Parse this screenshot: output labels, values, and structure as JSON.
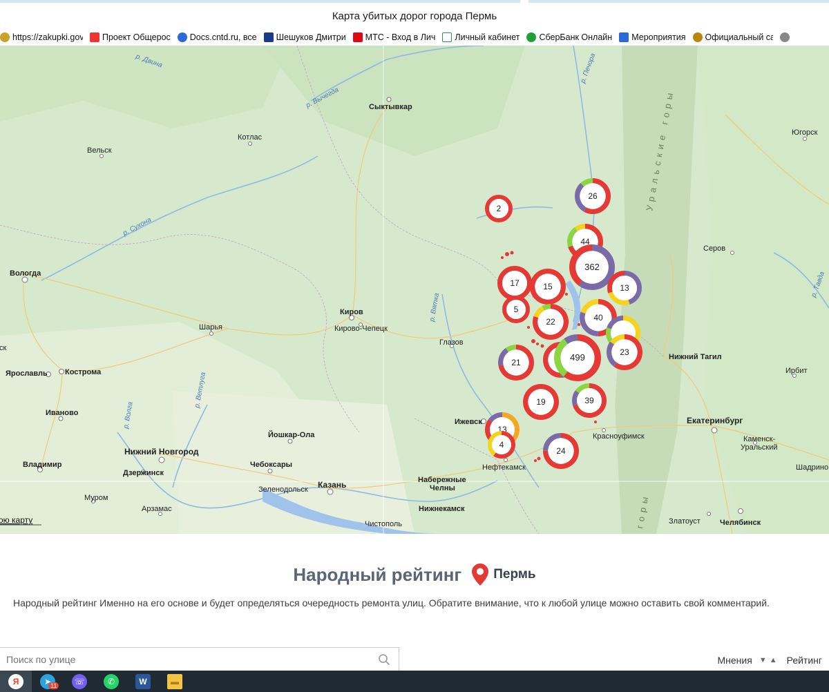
{
  "window": {
    "title": "Карта убитых дорог города Пермь"
  },
  "bookmarks": [
    {
      "label": "https://zakupki.gov",
      "icon": "emblem-icon",
      "color": "#c9a227"
    },
    {
      "label": "Проект Общерос",
      "icon": "doc-icon",
      "color": "#e33"
    },
    {
      "label": "Docs.cntd.ru, все",
      "icon": "docs-icon",
      "color": "#2a6ad8"
    },
    {
      "label": "Шешуков Дмитри",
      "icon": "flag-icon",
      "color": "#1b3a8a"
    },
    {
      "label": "МТС - Вход в Лич",
      "icon": "mts-icon",
      "color": "#e30613"
    },
    {
      "label": "Личный кабинет",
      "icon": "p-icon",
      "color": "#2e8b57"
    },
    {
      "label": "СберБанк Онлайн",
      "icon": "sber-icon",
      "color": "#21a038"
    },
    {
      "label": "Мероприятия",
      "icon": "id-icon",
      "color": "#2a6ad8"
    },
    {
      "label": "Официальный сай",
      "icon": "emblem-icon",
      "color": "#b8860b"
    }
  ],
  "map": {
    "cities": [
      {
        "name": "Сыктывкар",
        "bold": true
      },
      {
        "name": "Котлас",
        "bold": false
      },
      {
        "name": "Вельск",
        "bold": false
      },
      {
        "name": "Вологда",
        "bold": true
      },
      {
        "name": "Киров",
        "bold": true
      },
      {
        "name": "Кирово-Чепецк",
        "bold": false
      },
      {
        "name": "Шарья",
        "bold": false
      },
      {
        "name": "Ярославль",
        "bold": true
      },
      {
        "name": "Кострома",
        "bold": true
      },
      {
        "name": "Иваново",
        "bold": true
      },
      {
        "name": "Йошкар-Ола",
        "bold": true
      },
      {
        "name": "Нижний Новгород",
        "bold": true
      },
      {
        "name": "Дзержинск",
        "bold": true
      },
      {
        "name": "Владимир",
        "bold": true
      },
      {
        "name": "Чебоксары",
        "bold": true
      },
      {
        "name": "Казань",
        "bold": true
      },
      {
        "name": "Зеленодольск",
        "bold": false
      },
      {
        "name": "Муром",
        "bold": false
      },
      {
        "name": "Арзамас",
        "bold": false
      },
      {
        "name": "Глазов",
        "bold": false
      },
      {
        "name": "Ижевск",
        "bold": true
      },
      {
        "name": "Набережные",
        "bold": true
      },
      {
        "name": "Челны",
        "bold": true
      },
      {
        "name": "Нижнекамск",
        "bold": true
      },
      {
        "name": "Чистополь",
        "bold": false
      },
      {
        "name": "Нефтекамск",
        "bold": false
      },
      {
        "name": "Красноуфимск",
        "bold": false
      },
      {
        "name": "Нижний Тагил",
        "bold": true
      },
      {
        "name": "Екатеринбург",
        "bold": true
      },
      {
        "name": "Каменск-",
        "bold": false
      },
      {
        "name": "Уральский",
        "bold": false
      },
      {
        "name": "Златоуст",
        "bold": false
      },
      {
        "name": "Челябинск",
        "bold": true
      },
      {
        "name": "Ирбит",
        "bold": false
      },
      {
        "name": "Серов",
        "bold": false
      },
      {
        "name": "Югорск",
        "bold": false
      },
      {
        "name": "Шадрино",
        "bold": false
      }
    ],
    "rivers": [
      "р. Вычегда",
      "р. Сухона",
      "р. Вятка",
      "р. Ветлуга",
      "р. Волга",
      "р. Печора",
      "р. Тавда",
      "р. Двина"
    ],
    "mountains": [
      "Уральские горы",
      "горы"
    ],
    "link": "ою карту",
    "edge_label": "ск",
    "clusters": [
      {
        "count": "2",
        "segments": [
          {
            "color": "#e53935",
            "frac": 1
          }
        ]
      },
      {
        "count": "26",
        "segments": [
          {
            "color": "#e53935",
            "frac": 0.58
          },
          {
            "color": "#7b6aa8",
            "frac": 0.3
          },
          {
            "color": "#8bd640",
            "frac": 0.12
          }
        ]
      },
      {
        "count": "44",
        "segments": [
          {
            "color": "#e53935",
            "frac": 0.7
          },
          {
            "color": "#8bd640",
            "frac": 0.2
          },
          {
            "color": "#f5d21e",
            "frac": 0.1
          }
        ]
      },
      {
        "count": "362",
        "segments": [
          {
            "color": "#7b6aa8",
            "frac": 0.6
          },
          {
            "color": "#e53935",
            "frac": 0.4
          }
        ]
      },
      {
        "count": "13",
        "segments": [
          {
            "color": "#7b6aa8",
            "frac": 0.45
          },
          {
            "color": "#f5d21e",
            "frac": 0.25
          },
          {
            "color": "#e53935",
            "frac": 0.3
          }
        ]
      },
      {
        "count": "17",
        "segments": [
          {
            "color": "#e53935",
            "frac": 1
          }
        ]
      },
      {
        "count": "15",
        "segments": [
          {
            "color": "#e53935",
            "frac": 1
          }
        ]
      },
      {
        "count": "5",
        "segments": [
          {
            "color": "#e53935",
            "frac": 1
          }
        ]
      },
      {
        "count": "22",
        "segments": [
          {
            "color": "#e53935",
            "frac": 0.8
          },
          {
            "color": "#f5d21e",
            "frac": 0.12
          },
          {
            "color": "#8bd640",
            "frac": 0.08
          }
        ]
      },
      {
        "count": "40",
        "segments": [
          {
            "color": "#e53935",
            "frac": 0.5
          },
          {
            "color": "#7b6aa8",
            "frac": 0.3
          },
          {
            "color": "#f5d21e",
            "frac": 0.2
          }
        ]
      },
      {
        "count": "",
        "segments": [
          {
            "color": "#f5d21e",
            "frac": 0.55
          },
          {
            "color": "#8bd640",
            "frac": 0.25
          },
          {
            "color": "#7b6aa8",
            "frac": 0.2
          }
        ]
      },
      {
        "count": "21",
        "segments": [
          {
            "color": "#e53935",
            "frac": 0.72
          },
          {
            "color": "#7b6aa8",
            "frac": 0.18
          },
          {
            "color": "#8bd640",
            "frac": 0.1
          }
        ]
      },
      {
        "count": "",
        "segments": [
          {
            "color": "#7b6aa8",
            "frac": 0.5
          },
          {
            "color": "#e53935",
            "frac": 0.5
          }
        ]
      },
      {
        "count": "499",
        "segments": [
          {
            "color": "#e53935",
            "frac": 0.6
          },
          {
            "color": "#8bd640",
            "frac": 0.3
          },
          {
            "color": "#7b6aa8",
            "frac": 0.1
          }
        ]
      },
      {
        "count": "23",
        "segments": [
          {
            "color": "#e53935",
            "frac": 0.6
          },
          {
            "color": "#7b6aa8",
            "frac": 0.25
          },
          {
            "color": "#f5d21e",
            "frac": 0.15
          }
        ]
      },
      {
        "count": "19",
        "segments": [
          {
            "color": "#e53935",
            "frac": 1
          }
        ]
      },
      {
        "count": "39",
        "segments": [
          {
            "color": "#e53935",
            "frac": 0.7
          },
          {
            "color": "#7b6aa8",
            "frac": 0.15
          },
          {
            "color": "#8bd640",
            "frac": 0.15
          }
        ]
      },
      {
        "count": "13",
        "segments": [
          {
            "color": "#f5a623",
            "frac": 0.4
          },
          {
            "color": "#e53935",
            "frac": 0.45
          },
          {
            "color": "#7b6aa8",
            "frac": 0.15
          }
        ]
      },
      {
        "count": "4",
        "segments": [
          {
            "color": "#e53935",
            "frac": 0.6
          },
          {
            "color": "#f5d21e",
            "frac": 0.4
          }
        ]
      },
      {
        "count": "24",
        "segments": [
          {
            "color": "#e53935",
            "frac": 0.75
          },
          {
            "color": "#7b6aa8",
            "frac": 0.25
          }
        ]
      }
    ]
  },
  "rating": {
    "title": "Народный рейтинг",
    "city": "Пермь",
    "description": "Народный рейтинг Именно на его основе и будет определяться очередность ремонта улиц. Обратите внимание, что к любой улице можно оставить свой комментарий.",
    "search_placeholder": "Поиск по улице",
    "sort_opinions": "Мнения",
    "sort_rating": "Рейтинг"
  },
  "taskbar": {
    "apps": [
      {
        "name": "yandex-app",
        "glyph": "Я",
        "color": "#fc3f1d"
      },
      {
        "name": "telegram-app",
        "glyph": "➤",
        "color": "#2aa3df",
        "badge": "11"
      },
      {
        "name": "viber-app",
        "glyph": "☏",
        "color": "#7360f2"
      },
      {
        "name": "whatsapp-app",
        "glyph": "✆",
        "color": "#25d366"
      },
      {
        "name": "word-app",
        "glyph": "W",
        "color": "#2b579a"
      },
      {
        "name": "explorer-app",
        "glyph": "▬",
        "color": "#f4c542"
      }
    ]
  }
}
